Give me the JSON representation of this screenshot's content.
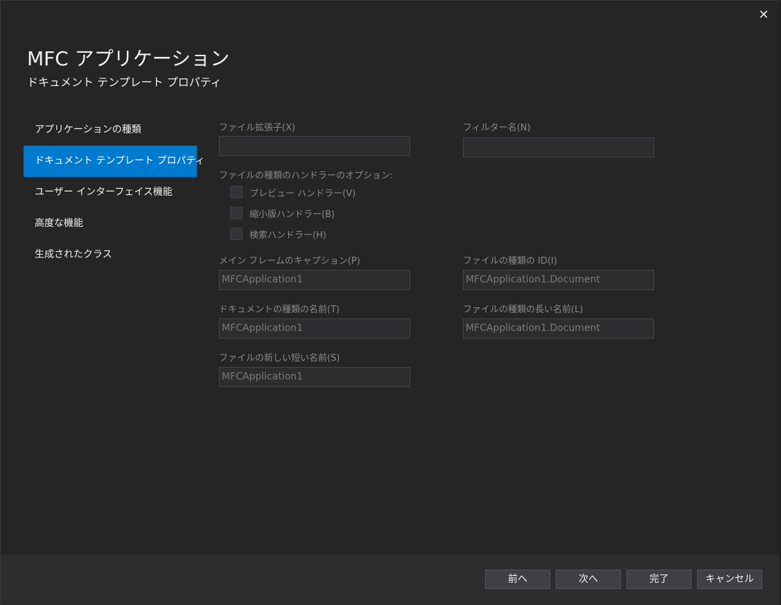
{
  "dialog": {
    "close_glyph": "✕",
    "title": "MFC アプリケーション",
    "subtitle": "ドキュメント テンプレート プロパティ"
  },
  "nav": {
    "items": [
      {
        "label": "アプリケーションの種類"
      },
      {
        "label": "ドキュメント テンプレート プロパティ"
      },
      {
        "label": "ユーザー インターフェイス機能"
      },
      {
        "label": "高度な機能"
      },
      {
        "label": "生成されたクラス"
      }
    ],
    "active_index": 1
  },
  "form": {
    "file_extension": {
      "label": "ファイル拡張子(X)",
      "value": ""
    },
    "filter_name": {
      "label": "フィルター名(N)",
      "value": ""
    },
    "handler_options_label": "ファイルの種類のハンドラーのオプション:",
    "handlers": [
      {
        "label": "プレビュー ハンドラー(V)",
        "checked": false
      },
      {
        "label": "縮小版ハンドラー(B)",
        "checked": false
      },
      {
        "label": "検索ハンドラー(H)",
        "checked": false
      }
    ],
    "main_frame_caption": {
      "label": "メイン フレームのキャプション(P)",
      "value": "MFCApplication1"
    },
    "file_type_id": {
      "label": "ファイルの種類の ID(I)",
      "value": "MFCApplication1.Document"
    },
    "doc_type_name": {
      "label": "ドキュメントの種類の名前(T)",
      "value": "MFCApplication1"
    },
    "file_type_long_name": {
      "label": "ファイルの種類の長い名前(L)",
      "value": "MFCApplication1.Document"
    },
    "file_new_short_name": {
      "label": "ファイルの新しい短い名前(S)",
      "value": "MFCApplication1"
    }
  },
  "footer": {
    "back_label": "前へ",
    "next_label": "次へ",
    "finish_label": "完了",
    "cancel_label": "キャンセル"
  },
  "colors": {
    "background": "#252526",
    "accent": "#007acc",
    "footer": "#2d2d30"
  }
}
